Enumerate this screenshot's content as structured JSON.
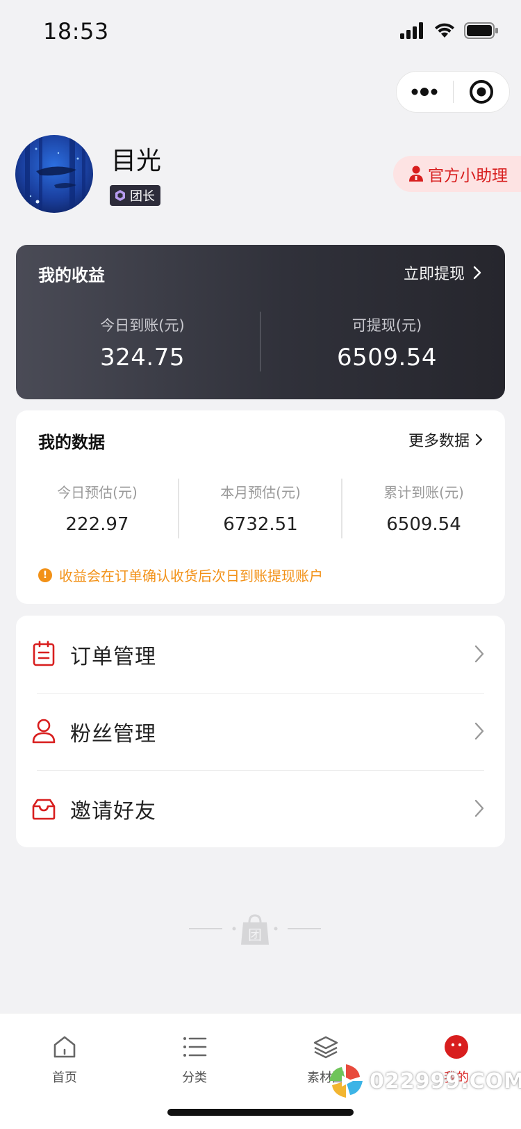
{
  "status_bar": {
    "time": "18:53"
  },
  "profile": {
    "name": "目光",
    "role_badge": "团长",
    "assistant_button": "官方小助理"
  },
  "earnings": {
    "title": "我的收益",
    "withdraw_label": "立即提现",
    "today_label": "今日到账(元)",
    "today_value": "324.75",
    "withdrawable_label": "可提现(元)",
    "withdrawable_value": "6509.54"
  },
  "data_section": {
    "title": "我的数据",
    "more_label": "更多数据",
    "stats": [
      {
        "label": "今日预估(元)",
        "value": "222.97"
      },
      {
        "label": "本月预估(元)",
        "value": "6732.51"
      },
      {
        "label": "累计到账(元)",
        "value": "6509.54"
      }
    ],
    "notice": "收益会在订单确认收货后次日到账提现账户"
  },
  "menu": [
    {
      "label": "订单管理",
      "icon": "clipboard-icon"
    },
    {
      "label": "粉丝管理",
      "icon": "user-icon"
    },
    {
      "label": "邀请好友",
      "icon": "inbox-icon"
    }
  ],
  "tabbar": [
    {
      "label": "首页",
      "icon": "home-icon"
    },
    {
      "label": "分类",
      "icon": "list-icon"
    },
    {
      "label": "素材圈",
      "icon": "layers-icon"
    },
    {
      "label": "我的",
      "icon": "face-icon",
      "active": true
    }
  ],
  "footer_logo_text": "团",
  "watermark": "022999.COM",
  "colors": {
    "accent": "#d81e1e",
    "warning": "#f29117",
    "card_dark": "#30313a",
    "background": "#f2f2f4"
  }
}
